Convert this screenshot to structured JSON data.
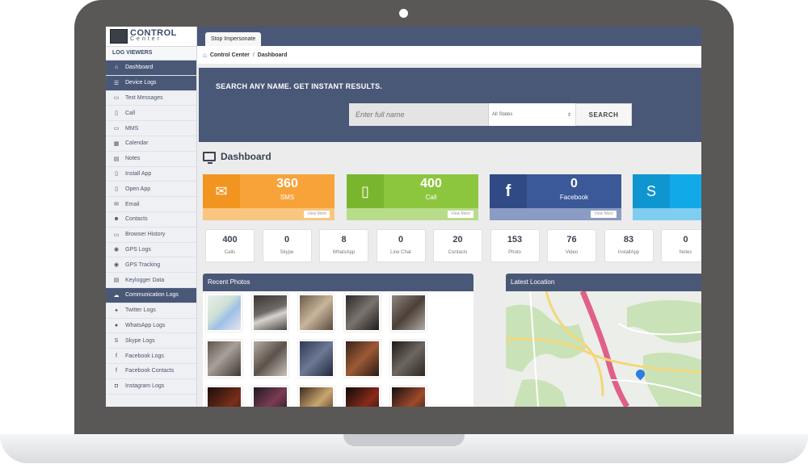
{
  "sidebar": {
    "logo_main": "CONTROL",
    "logo_sub": "Center",
    "section_title": "LOG VIEWERS",
    "items": [
      {
        "label": "Dashboard",
        "icon": "home-icon",
        "glyph": "⌂",
        "active": true
      },
      {
        "label": "Device Logs",
        "icon": "list-icon",
        "glyph": "☰",
        "active": true
      },
      {
        "label": "Text Messages",
        "icon": "message-icon",
        "glyph": "▭",
        "active": false
      },
      {
        "label": "Call",
        "icon": "phone-icon",
        "glyph": "▯",
        "active": false
      },
      {
        "label": "MMS",
        "icon": "mms-icon",
        "glyph": "▭",
        "active": false
      },
      {
        "label": "Calendar",
        "icon": "calendar-icon",
        "glyph": "▦",
        "active": false
      },
      {
        "label": "Notes",
        "icon": "notes-icon",
        "glyph": "▤",
        "active": false
      },
      {
        "label": "Install App",
        "icon": "install-app-icon",
        "glyph": "▯",
        "active": false
      },
      {
        "label": "Open App",
        "icon": "open-app-icon",
        "glyph": "▯",
        "active": false
      },
      {
        "label": "Email",
        "icon": "email-icon",
        "glyph": "✉",
        "active": false
      },
      {
        "label": "Contacts",
        "icon": "contacts-icon",
        "glyph": "☻",
        "active": false
      },
      {
        "label": "Browser History",
        "icon": "browser-icon",
        "glyph": "▭",
        "active": false
      },
      {
        "label": "GPS Logs",
        "icon": "location-icon",
        "glyph": "◉",
        "active": false
      },
      {
        "label": "GPS Tracking",
        "icon": "tracking-icon",
        "glyph": "◉",
        "active": false
      },
      {
        "label": "Keylogger Data",
        "icon": "keyboard-icon",
        "glyph": "▤",
        "active": false
      },
      {
        "label": "Communication Logs",
        "icon": "cloud-icon",
        "glyph": "☁",
        "active": true
      },
      {
        "label": "Twitter Logs",
        "icon": "twitter-icon",
        "glyph": "✦",
        "active": false
      },
      {
        "label": "WhatsApp Logs",
        "icon": "whatsapp-icon",
        "glyph": "●",
        "active": false
      },
      {
        "label": "Skype Logs",
        "icon": "skype-icon",
        "glyph": "S",
        "active": false
      },
      {
        "label": "Facebook Logs",
        "icon": "facebook-icon",
        "glyph": "f",
        "active": false
      },
      {
        "label": "Facebook Contacts",
        "icon": "facebook-contacts-icon",
        "glyph": "f",
        "active": false
      },
      {
        "label": "Instagram Logs",
        "icon": "instagram-icon",
        "glyph": "◘",
        "active": false
      }
    ]
  },
  "topbar": {
    "impersonate_label": "Stop Impersonate"
  },
  "breadcrumb": {
    "root": "Control Center",
    "current": "Dashboard"
  },
  "search": {
    "title": "SEARCH ANY NAME. GET INSTANT RESULTS.",
    "placeholder": "Enter full name",
    "state_value": "All States",
    "button_label": "SEARCH"
  },
  "dashboard": {
    "title": "Dashboard",
    "cards": [
      {
        "value": "360",
        "label": "SMS",
        "icon": "envelope-icon",
        "color": "#f7a33a",
        "dark": "#f29520",
        "light": "#f9c680",
        "view_more": "View More"
      },
      {
        "value": "400",
        "label": "Call",
        "icon": "mobile-icon",
        "color": "#8cc63f",
        "dark": "#7ab52e",
        "light": "#b9dc8a",
        "view_more": "View More"
      },
      {
        "value": "0",
        "label": "Facebook",
        "icon": "facebook-icon",
        "color": "#3b5998",
        "dark": "#2f4a85",
        "light": "#8a9cc3",
        "view_more": "View More"
      },
      {
        "value": "",
        "label": "",
        "icon": "skype-icon",
        "color": "#12a9e8",
        "dark": "#0f96d0",
        "light": "#7fcdf0",
        "view_more": ""
      }
    ],
    "counts": [
      {
        "value": "400",
        "label": "Calls"
      },
      {
        "value": "0",
        "label": "Skype"
      },
      {
        "value": "8",
        "label": "WhatsApp"
      },
      {
        "value": "0",
        "label": "Line Chat"
      },
      {
        "value": "20",
        "label": "Contacts"
      },
      {
        "value": "153",
        "label": "Photo"
      },
      {
        "value": "76",
        "label": "Video"
      },
      {
        "value": "83",
        "label": "InstallApp"
      },
      {
        "value": "0",
        "label": "Notes"
      }
    ],
    "recent_photos_title": "Recent Photos",
    "latest_location_title": "Latest Location"
  }
}
